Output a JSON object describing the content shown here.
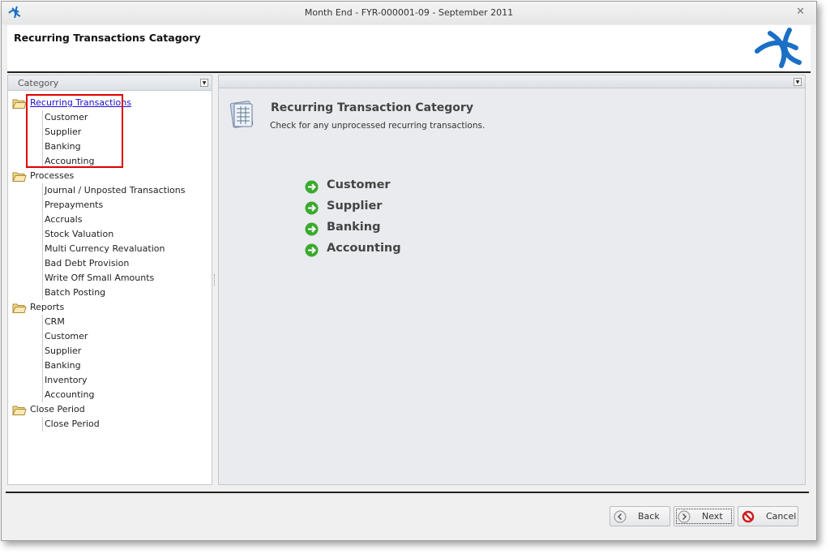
{
  "window": {
    "title": "Month End - FYR-000001-09 - September 2011"
  },
  "header": {
    "title": "Recurring Transactions Catagory"
  },
  "left_panel": {
    "title": "Category",
    "groups": [
      {
        "label": "Recurring Transactions",
        "children": [
          "Customer",
          "Supplier",
          "Banking",
          "Accounting"
        ]
      },
      {
        "label": "Processes",
        "children": [
          "Journal / Unposted Transactions",
          "Prepayments",
          "Accruals",
          "Stock Valuation",
          "Multi Currency Revaluation",
          "Bad Debt Provision",
          "Write Off Small Amounts",
          "Batch Posting"
        ]
      },
      {
        "label": "Reports",
        "children": [
          "CRM",
          "Customer",
          "Supplier",
          "Banking",
          "Inventory",
          "Accounting"
        ]
      },
      {
        "label": "Close Period",
        "children": [
          "Close Period"
        ]
      }
    ]
  },
  "main": {
    "title": "Recurring Transaction Category",
    "subtitle": "Check for any unprocessed recurring transactions.",
    "items": [
      "Customer",
      "Supplier",
      "Banking",
      "Accounting"
    ]
  },
  "footer": {
    "back": "Back",
    "next": "Next",
    "cancel": "Cancel"
  },
  "colors": {
    "highlight": "#e00000",
    "link": "#1a0dcc",
    "arrow": "#3aa92d"
  }
}
